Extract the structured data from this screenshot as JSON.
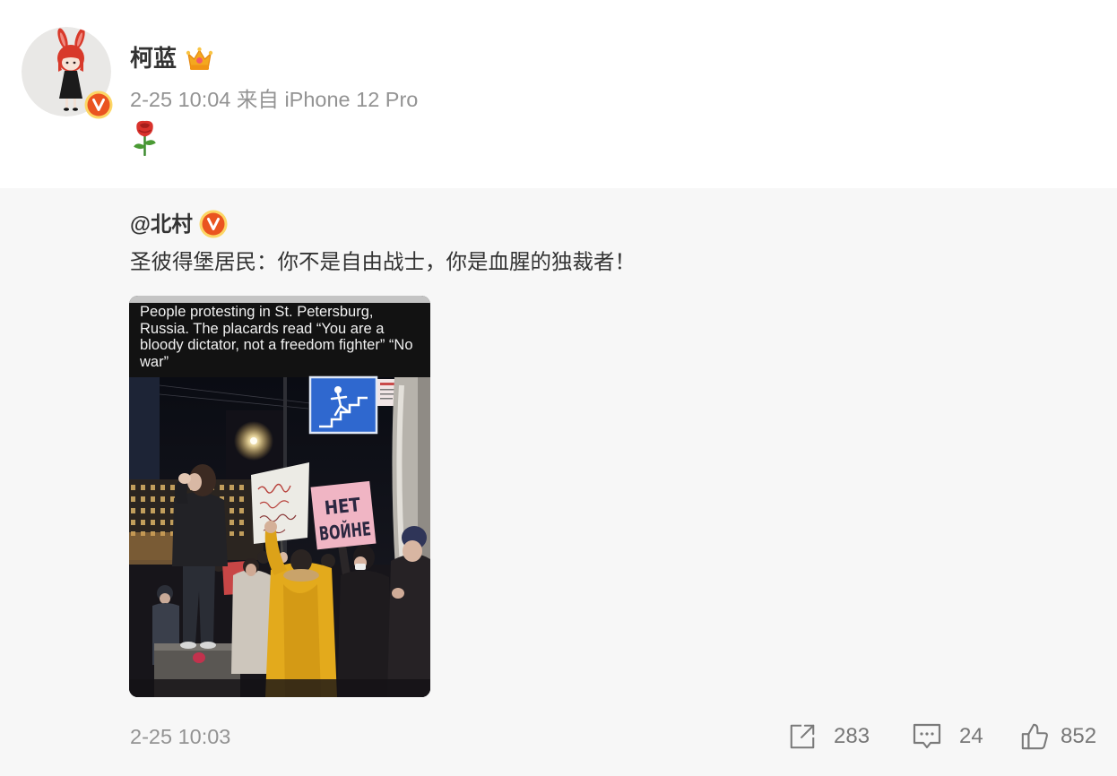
{
  "post": {
    "author": {
      "name": "柯蓝",
      "avatar_icon": "avatar-bunny-girl",
      "badge_icon": "verified-v-badge-icon",
      "crown_icon": "crown-icon"
    },
    "timestamp": "2-25 10:04",
    "source_prefix": "来自",
    "source_device": "iPhone 12 Pro",
    "content_icon": "rose-icon"
  },
  "repost": {
    "author": "@北村",
    "badge_icon": "verified-v-badge-icon",
    "text": "圣彼得堡居民：你不是自由战士，你是血腥的独裁者！",
    "image": {
      "caption_lines": [
        "People protesting in St. Petersburg,",
        "Russia. The placards read “You are a",
        "bloody dictator, not a freedom fighter” “No",
        "war”"
      ],
      "placard_lines": [
        "НЕТ",
        "ВОЙНЕ"
      ]
    },
    "timestamp": "2-25 10:03",
    "actions": {
      "share": {
        "icon": "share-icon",
        "count": "283"
      },
      "comment": {
        "icon": "comment-icon",
        "count": "24"
      },
      "like": {
        "icon": "like-icon",
        "count": "852"
      }
    }
  },
  "colors": {
    "page_bg": "#ffffff",
    "repost_bg": "#f7f7f7",
    "text_primary": "#333333",
    "text_meta": "#939393",
    "action_count": "#777777",
    "badge_orange": "#ea5420",
    "badge_ring": "#fcd665"
  }
}
